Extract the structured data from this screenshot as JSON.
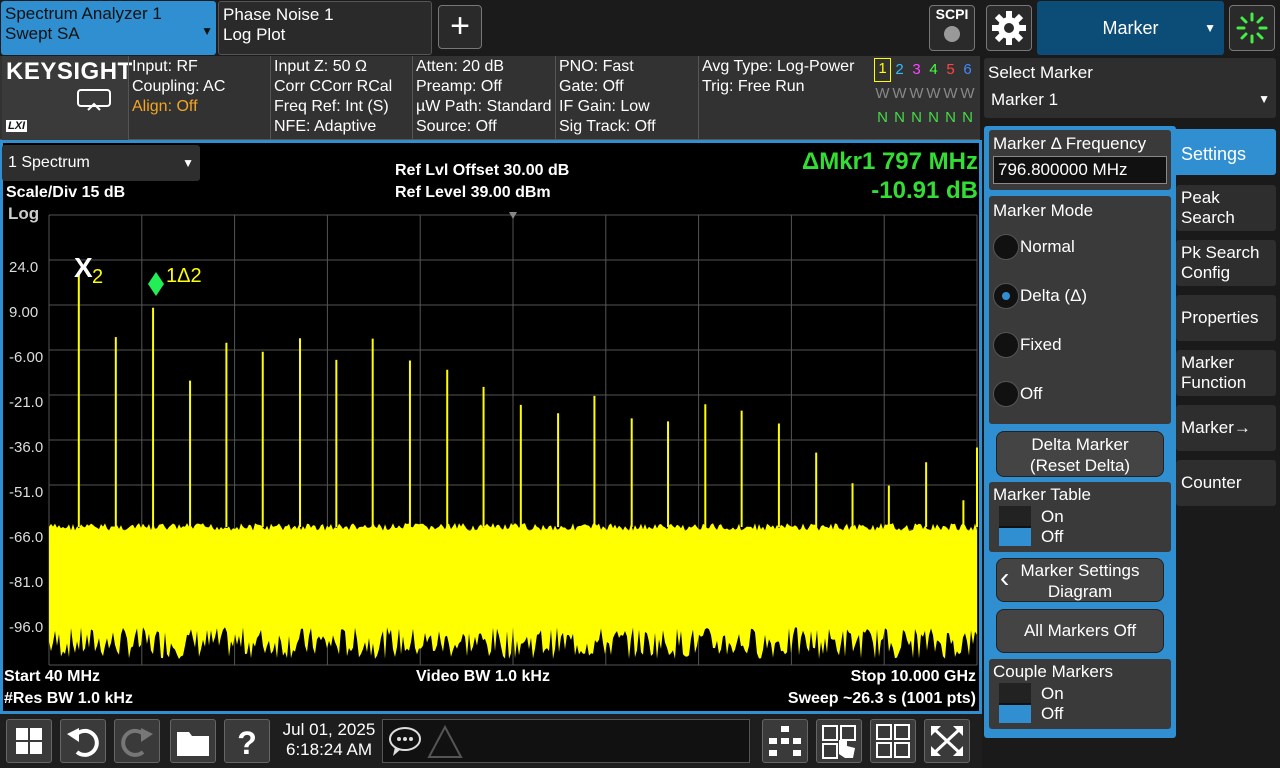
{
  "tabs": [
    {
      "line1": "Spectrum Analyzer 1",
      "line2": "Swept SA"
    },
    {
      "line1": "Phase Noise 1",
      "line2": "Log Plot"
    }
  ],
  "add_tab_label": "+",
  "scpi_label": "SCPI",
  "menu_title": "Marker",
  "brand": "KEYSIGHT",
  "lxi_label": "LXI",
  "info_columns": [
    [
      "Input: RF",
      "Coupling: AC",
      "Align: Off"
    ],
    [
      "Input Z: 50 Ω",
      "Corr CCorr RCal",
      "Freq Ref: Int (S)",
      "NFE: Adaptive"
    ],
    [
      "Atten: 20 dB",
      "Preamp: Off",
      "µW Path: Standard",
      "Source: Off"
    ],
    [
      "PNO: Fast",
      "Gate: Off",
      "IF Gain: Low",
      "Sig Track: Off"
    ],
    [
      "Avg Type: Log-Power",
      "Trig: Free Run"
    ]
  ],
  "trace_numbers": [
    "1",
    "2",
    "3",
    "4",
    "5",
    "6"
  ],
  "trace_number_colors": [
    "#ffff00",
    "#33bbff",
    "#ff44ff",
    "#44ff44",
    "#ff4444",
    "#4488ff"
  ],
  "trace_types": [
    "W",
    "W",
    "W",
    "W",
    "W",
    "W"
  ],
  "trace_detectors": [
    "N",
    "N",
    "N",
    "N",
    "N",
    "N"
  ],
  "plot": {
    "trace_selector": "1 Spectrum",
    "scale": "Scale/Div 15 dB",
    "scale_type": "Log",
    "ref_offset": "Ref Lvl Offset 30.00 dB",
    "ref_level": "Ref Level 39.00 dBm",
    "marker_readout_freq": "ΔMkr1  797 MHz",
    "marker_readout_level": "-10.91 dB",
    "y_ticks": [
      "24.0",
      "9.00",
      "-6.00",
      "-21.0",
      "-36.0",
      "-51.0",
      "-66.0",
      "-81.0",
      "-96.0"
    ],
    "start": "Start 40 MHz",
    "stop": "Stop 10.000 GHz",
    "vbw": "Video BW 1.0 kHz",
    "rbw": "#Res BW 1.0 kHz",
    "sweep": "Sweep ~26.3 s  (1001 pts)",
    "marker2_label": "2",
    "marker2_symbol": "X",
    "marker1_label": "1Δ2",
    "trace_color": "#ffff00"
  },
  "chart_data": {
    "type": "line",
    "title": "",
    "xlabel": "",
    "ylabel": "",
    "xlim_mhz": [
      40,
      10000
    ],
    "ylim_dbm": [
      -111,
      39
    ],
    "y_ticks": [
      24,
      9,
      -6,
      -21,
      -36,
      -51,
      -66,
      -81,
      -96
    ],
    "noise_floor_dbm": -65,
    "spurs": [
      {
        "freq_mhz": 360,
        "level_dbm": 19
      },
      {
        "freq_mhz": 757,
        "level_dbm": -1.7
      },
      {
        "freq_mhz": 1157,
        "level_dbm": 8.1
      },
      {
        "freq_mhz": 1554,
        "level_dbm": -16.2
      },
      {
        "freq_mhz": 1944,
        "level_dbm": -3.6
      },
      {
        "freq_mhz": 2334,
        "level_dbm": -6.6
      },
      {
        "freq_mhz": 2734,
        "level_dbm": -2.1
      },
      {
        "freq_mhz": 3124,
        "level_dbm": -9.3
      },
      {
        "freq_mhz": 3514,
        "level_dbm": -2.2
      },
      {
        "freq_mhz": 3914,
        "level_dbm": -9.5
      },
      {
        "freq_mhz": 4314,
        "level_dbm": -12.6
      },
      {
        "freq_mhz": 4704,
        "level_dbm": -18.3
      },
      {
        "freq_mhz": 5104,
        "level_dbm": -24.3
      },
      {
        "freq_mhz": 5504,
        "level_dbm": -27.1
      },
      {
        "freq_mhz": 5894,
        "level_dbm": -21.3
      },
      {
        "freq_mhz": 6294,
        "level_dbm": -28.8
      },
      {
        "freq_mhz": 6684,
        "level_dbm": -29.8
      },
      {
        "freq_mhz": 7084,
        "level_dbm": -24.1
      },
      {
        "freq_mhz": 7474,
        "level_dbm": -26.2
      },
      {
        "freq_mhz": 7874,
        "level_dbm": -30.5
      },
      {
        "freq_mhz": 8274,
        "level_dbm": -40.2
      },
      {
        "freq_mhz": 8664,
        "level_dbm": -50.4
      },
      {
        "freq_mhz": 9054,
        "level_dbm": -51.2
      },
      {
        "freq_mhz": 9454,
        "level_dbm": -43.4
      },
      {
        "freq_mhz": 9854,
        "level_dbm": -56.1
      },
      {
        "freq_mhz": 10000,
        "level_dbm": -38.5
      }
    ],
    "grid": true
  },
  "right_panel": {
    "select_marker_label": "Select Marker",
    "select_marker_value": "Marker 1",
    "freq_label": "Marker Δ Frequency",
    "freq_value": "796.800000 MHz",
    "mode_label": "Marker Mode",
    "modes": [
      "Normal",
      "Delta (Δ)",
      "Fixed",
      "Off"
    ],
    "selected_mode_index": 1,
    "delta_btn_line1": "Delta Marker",
    "delta_btn_line2": "(Reset Delta)",
    "marker_table_label": "Marker Table",
    "on_label": "On",
    "off_label": "Off",
    "settings_diagram_line1": "Marker Settings",
    "settings_diagram_line2": "Diagram",
    "all_off_label": "All Markers Off",
    "couple_label": "Couple Markers",
    "tabs": [
      {
        "line1": "Settings",
        "line2": ""
      },
      {
        "line1": "Peak",
        "line2": "Search"
      },
      {
        "line1": "Pk Search",
        "line2": "Config"
      },
      {
        "line1": "Properties",
        "line2": ""
      },
      {
        "line1": "Marker",
        "line2": "Function"
      },
      {
        "line1": "Marker→",
        "line2": ""
      },
      {
        "line1": "Counter",
        "line2": ""
      }
    ]
  },
  "bottom": {
    "date": "Jul 01, 2025",
    "time": "6:18:24 AM"
  },
  "icons": [
    "windows-icon",
    "undo-icon",
    "redo-icon",
    "folder-icon",
    "help-icon",
    "chat-icon",
    "warning-icon",
    "layout-icon",
    "touch-icon",
    "quad-window-icon",
    "expand-icon",
    "gear-icon",
    "busy-icon",
    "return-icon"
  ]
}
